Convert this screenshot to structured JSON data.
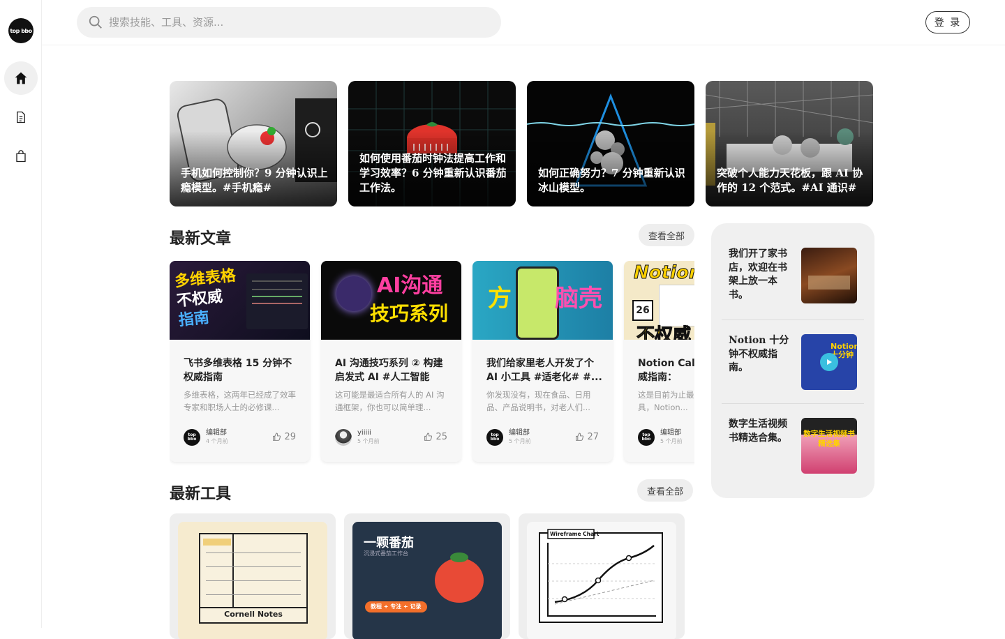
{
  "brand": {
    "logo_text": "top bbo"
  },
  "search": {
    "placeholder": "搜索技能、工具、资源..."
  },
  "header": {
    "login_label": "登 录"
  },
  "sidebar": {
    "items": [
      {
        "name": "home",
        "icon": "home-icon",
        "active": true
      },
      {
        "name": "articles",
        "icon": "document-icon",
        "active": false
      },
      {
        "name": "shop",
        "icon": "shopping-bag-icon",
        "active": false
      }
    ]
  },
  "banners": [
    {
      "caption": "手机如何控制你？9 分钟认识上瘾模型。#手机瘾#"
    },
    {
      "caption": "如何使用番茄时钟法提高工作和学习效率？6 分钟重新认识番茄工作法。"
    },
    {
      "caption": "如何正确努力？7 分钟重新认识冰山模型。"
    },
    {
      "caption": "突破个人能力天花板，跟 AI 协作的 12 个范式。#AI 通识#"
    }
  ],
  "latest_articles": {
    "title": "最新文章",
    "view_all": "查看全部",
    "cards": [
      {
        "thumb_text_1": "多维表格",
        "thumb_text_2": "不权威",
        "thumb_text_3": "指南",
        "title": "飞书多维表格 15 分钟不权威指南",
        "desc": "多维表格，这两年已经成了效率专家和职场人士的必修课...",
        "author": "编辑部",
        "time": "4 个月前",
        "likes": "29"
      },
      {
        "thumb_text_1": "AI沟通",
        "thumb_text_2": "技巧系列",
        "thumb_text_3": "",
        "title": "AI 沟通技巧系列 ② 构建启发式 AI #人工智能 #...",
        "desc": "这可能是最适合所有人的 AI 沟通框架，你也可以简单理...",
        "author": "yiiiii",
        "time": "5 个月前",
        "likes": "25"
      },
      {
        "thumb_text_1": "方",
        "thumb_text_2": "脑壳",
        "thumb_text_3": "",
        "title": "我们给家里老人开发了个 AI 小工具 #适老化# #...",
        "desc": "你发现没有，现在食品、日用品、产品说明书，对老人们...",
        "author": "编辑部",
        "time": "5 个月前",
        "likes": "27"
      },
      {
        "thumb_text_1": "Notion",
        "thumb_text_2": "不权威",
        "thumb_text_3": "26",
        "title": "Notion Calendar 不权威指南：",
        "desc": "这是目前为止最好用的日历工具，Notion...",
        "author": "编辑部",
        "time": "5 个月前",
        "likes": ""
      }
    ]
  },
  "featured": [
    {
      "text": "我们开了家书店，欢迎在书架上放一本书。"
    },
    {
      "text": "Notion 十分钟不权威指南。",
      "thumb_text": "Notion 十分钟"
    },
    {
      "text": "数字生活视频书精选合集。",
      "thumb_text": "数字生活视频书 精选集"
    }
  ],
  "latest_tools": {
    "title": "最新工具",
    "view_all": "查看全部",
    "items": [
      {
        "label": "Cornell Notes"
      },
      {
        "title": "一颗番茄",
        "subtitle": "沉浸式番茄工作台",
        "tag": "教程 + 专注 + 记录"
      },
      {
        "label": "Wireframe Chart"
      }
    ]
  }
}
